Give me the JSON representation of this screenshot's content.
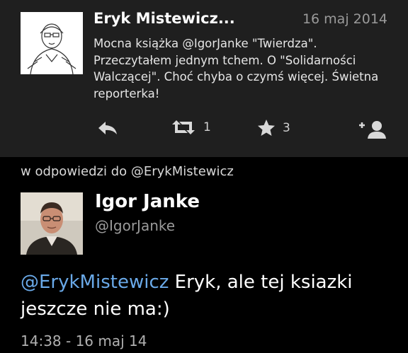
{
  "original_tweet": {
    "author": "Eryk Mistewicz...",
    "date": "16 maj 2014",
    "text": "Mocna książka @IgorJanke \"Twierdza\". Przeczytałem jednym tchem. O \"Solidarności Walczącej\". Choć chyba o czymś więcej. Świetna reporterka!",
    "retweet_count": "1",
    "favorite_count": "3"
  },
  "reply": {
    "context": "w odpowiedzi do @ErykMistewicz",
    "author": "Igor Janke",
    "handle": "@IgorJanke",
    "mention": "@ErykMistewicz",
    "text": " Eryk, ale tej ksiazki jeszcze nie ma:)",
    "timestamp": "14:38 - 16 maj 14"
  },
  "icons": {
    "reply": "reply-icon",
    "retweet": "retweet-icon",
    "favorite": "star-icon",
    "follow": "add-user-icon"
  },
  "colors": {
    "card_bg": "#1f1f1f",
    "page_bg": "#000000",
    "mention": "#6aa9e8",
    "muted": "#9a9a9a"
  }
}
